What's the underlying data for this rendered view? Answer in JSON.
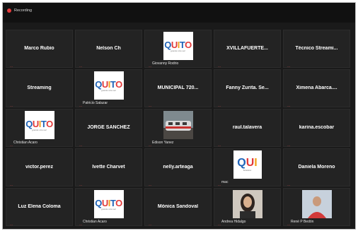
{
  "window": {
    "recording_label": "Recording",
    "rec_color": "#e53b3b"
  },
  "participants": [
    {
      "name": "Marco Rubio",
      "caption": "",
      "media": "none"
    },
    {
      "name": "Nelson Ch",
      "caption": "",
      "media": "none"
    },
    {
      "name": "",
      "caption": "Giovanny Rodrio",
      "media": "quito-logo"
    },
    {
      "name": "XVILLAFUERTE...",
      "caption": "",
      "media": "none"
    },
    {
      "name": "Técnico Streami...",
      "caption": "",
      "media": "none"
    },
    {
      "name": "Streaming",
      "caption": "",
      "media": "none"
    },
    {
      "name": "",
      "caption": "Patricio Salazar",
      "media": "quito-logo"
    },
    {
      "name": "MUNICIPAL 720...",
      "caption": "",
      "media": "none"
    },
    {
      "name": "Fanny Zurita. Se...",
      "caption": "",
      "media": "none"
    },
    {
      "name": "Ximena Abarca....",
      "caption": "",
      "media": "none"
    },
    {
      "name": "",
      "caption": "Christian Acaro",
      "media": "quito-logo"
    },
    {
      "name": "JORGE SANCHEZ",
      "caption": "",
      "media": "none"
    },
    {
      "name": "",
      "caption": "Edison Yanez",
      "media": "train-photo"
    },
    {
      "name": "raul.talavera",
      "caption": "",
      "media": "none"
    },
    {
      "name": "karina.escobar",
      "caption": "",
      "media": "none"
    },
    {
      "name": "victor.perez",
      "caption": "",
      "media": "none"
    },
    {
      "name": "Ivette Charvet",
      "caption": "",
      "media": "none"
    },
    {
      "name": "nelly.arteaga",
      "caption": "",
      "media": "none"
    },
    {
      "name": "",
      "caption": "mac",
      "media": "qui-logo"
    },
    {
      "name": "Daniela Moreno",
      "caption": "",
      "media": "none"
    },
    {
      "name": "Luz Elena Coloma",
      "caption": "",
      "media": "none"
    },
    {
      "name": "",
      "caption": "Christian Acaro",
      "media": "quito-logo"
    },
    {
      "name": "Mónica Sandoval",
      "caption": "",
      "media": "none"
    },
    {
      "name": "",
      "caption": "Andrea Hidalgo",
      "media": "woman-photo"
    },
    {
      "name": "",
      "caption": "René P Bedón",
      "media": "man-photo"
    }
  ],
  "logo_quito": {
    "main": "QUITO",
    "sub": "grande otra vez"
  },
  "logo_qui": {
    "main": "QUI",
    "sub": "Solidario"
  },
  "mute_icon": "mic-muted-icon",
  "mute_color": "#e04848"
}
